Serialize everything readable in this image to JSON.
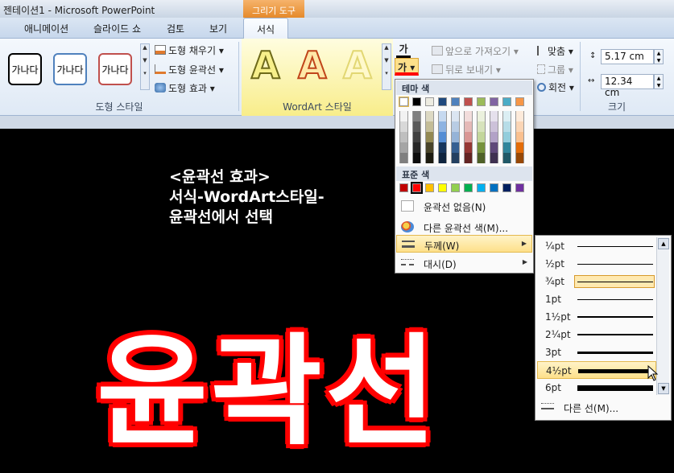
{
  "window": {
    "title": "젠테이션1 - Microsoft PowerPoint"
  },
  "context_group": {
    "label": "그리기 도구"
  },
  "tabs": [
    {
      "label": "애니메이션"
    },
    {
      "label": "슬라이드 쇼"
    },
    {
      "label": "검토"
    },
    {
      "label": "보기"
    },
    {
      "label": "서식",
      "active": true
    }
  ],
  "shape_styles": {
    "presets": [
      {
        "text": "가나다",
        "border": "#000000"
      },
      {
        "text": "가나다",
        "border": "#4f81bd"
      },
      {
        "text": "가나다",
        "border": "#c0504d"
      }
    ],
    "fill_label": "도형 채우기",
    "outline_label": "도형 윤곽선",
    "effects_label": "도형 효과",
    "group_label": "도형 스타일"
  },
  "wordart": {
    "letters": [
      {
        "char": "A",
        "fill": "#f7ef8a",
        "stroke": "#6e6a1a"
      },
      {
        "char": "A",
        "fill": "#ffe8a8",
        "stroke": "#c0451a"
      },
      {
        "char": "A",
        "fill": "#fff9cc",
        "stroke": "#e2d773"
      }
    ],
    "text_fill_label": "가",
    "text_outline_label": "가",
    "group_label": "WordArt 스타일"
  },
  "arrange": {
    "bring_forward": "앞으로 가져오기",
    "send_backward": "뒤로 보내기",
    "align": "맞춤",
    "group": "그룹",
    "rotate": "회전"
  },
  "size": {
    "height": "5.17 cm",
    "width": "12.34 cm",
    "group_label": "크기"
  },
  "slide": {
    "note_lines": [
      "<윤곽선 효과>",
      "서식-WordArt스타일-",
      "윤곽선에서 선택"
    ],
    "big_text": "윤곽선"
  },
  "outline_menu": {
    "theme_colors_header": "테마 색",
    "standard_colors_header": "표준 색",
    "theme_top_row": [
      "#ffffff",
      "#000000",
      "#eeece1",
      "#1f497d",
      "#4f81bd",
      "#c0504d",
      "#9bbb59",
      "#8064a2",
      "#4bacc6",
      "#f79646"
    ],
    "theme_columns": [
      [
        "#f2f2f2",
        "#d8d8d8",
        "#bfbfbf",
        "#a5a5a5",
        "#7f7f7f"
      ],
      [
        "#7f7f7f",
        "#595959",
        "#3f3f3f",
        "#262626",
        "#0c0c0c"
      ],
      [
        "#ddd9c3",
        "#c4bd97",
        "#938953",
        "#494429",
        "#1d1b10"
      ],
      [
        "#c6d9f0",
        "#8db3e2",
        "#548dd4",
        "#17365d",
        "#0f243e"
      ],
      [
        "#dbe5f1",
        "#b8cce4",
        "#95b3d7",
        "#366092",
        "#244061"
      ],
      [
        "#f2dcdb",
        "#e5b9b7",
        "#d99694",
        "#953734",
        "#632423"
      ],
      [
        "#ebf1dd",
        "#d7e3bc",
        "#c3d69b",
        "#76923c",
        "#4f6128"
      ],
      [
        "#e5e0ec",
        "#ccc1d9",
        "#b2a2c7",
        "#5f497a",
        "#3f3151"
      ],
      [
        "#dbeef3",
        "#b7dde8",
        "#92cddc",
        "#31859b",
        "#205867"
      ],
      [
        "#fdeada",
        "#fbd5b5",
        "#fac08f",
        "#e36c09",
        "#974806"
      ]
    ],
    "standard_colors": [
      "#c00000",
      "#ff0000",
      "#ffc000",
      "#ffff00",
      "#92d050",
      "#00b050",
      "#00b0f0",
      "#0070c0",
      "#002060",
      "#7030a0"
    ],
    "no_outline": "윤곽선 없음(N)",
    "more_colors": "다른 윤곽선 색(M)...",
    "weight": "두께(W)",
    "dashes": "대시(D)"
  },
  "weight_menu": {
    "items": [
      {
        "label": "¼pt",
        "thickness": 0.25
      },
      {
        "label": "½pt",
        "thickness": 0.5
      },
      {
        "label": "¾pt",
        "thickness": 0.75,
        "selected": true
      },
      {
        "label": "1pt",
        "thickness": 1
      },
      {
        "label": "1½pt",
        "thickness": 1.5
      },
      {
        "label": "2¼pt",
        "thickness": 2.25
      },
      {
        "label": "3pt",
        "thickness": 3
      },
      {
        "label": "4½pt",
        "thickness": 4.5,
        "hover": true
      },
      {
        "label": "6pt",
        "thickness": 6
      }
    ],
    "more_lines": "다른 선(M)..."
  }
}
